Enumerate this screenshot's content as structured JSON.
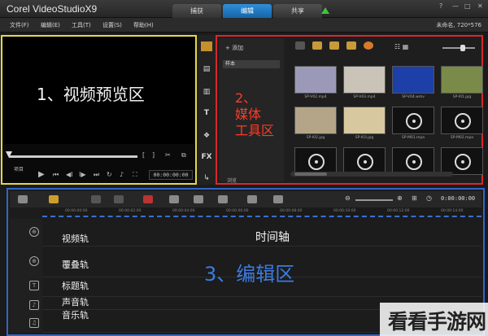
{
  "window": {
    "app_title": "Corel VideoStudioX9",
    "tabs": [
      "捕获",
      "编辑",
      "共享"
    ],
    "active_tab": "编辑",
    "controls": [
      "?",
      "—",
      "□",
      "✕"
    ]
  },
  "menu": {
    "items": [
      "文件(F)",
      "编辑(E)",
      "工具(T)",
      "设置(S)",
      "帮助(H)"
    ],
    "project_info": "未命名, 720*576"
  },
  "preview": {
    "region_label": "1、视频预览区",
    "mode_label": "项目",
    "timecode": "00:00:00:00"
  },
  "library": {
    "region_label": [
      "2、",
      "媒体",
      "工具区"
    ],
    "add_label": "添加",
    "folder_item": "样本",
    "browse_label": "浏览",
    "thumbnails": [
      {
        "caption": "SP-V02.mp4",
        "color": "#9a9ab8"
      },
      {
        "caption": "SP-V03.mp4",
        "color": "#c9c3b8"
      },
      {
        "caption": "SP-V04.wmv",
        "color": "#1d3fa8"
      },
      {
        "caption": "SP-I01.jpg",
        "color": "#7a8a48"
      },
      {
        "caption": "SP-I02.jpg",
        "color": "#b5a588"
      },
      {
        "caption": "SP-I03.jpg",
        "color": "#d8c8a0"
      },
      {
        "caption": "SP-M01.mpa",
        "color": "#111111"
      },
      {
        "caption": "SP-M02.mpa",
        "color": "#111111"
      },
      {
        "caption": "",
        "color": "#111111"
      },
      {
        "caption": "",
        "color": "#111111"
      },
      {
        "caption": "",
        "color": "#111111"
      },
      {
        "caption": "",
        "color": "#111111"
      }
    ]
  },
  "timeline": {
    "timecode": "0:00:00:00",
    "ruler": [
      "00:00:00:00",
      "00:00:02:00",
      "00:00:04:00",
      "00:00:06:00",
      "00:00:08:00",
      "00:00:10:00",
      "00:00:12:00",
      "00:00:14:00"
    ],
    "header_label": "时间轴",
    "region_label": "3、编辑区",
    "tracks": [
      "视频轨",
      "覆叠轨",
      "标题轨",
      "声音轨",
      "音乐轨"
    ]
  },
  "watermark": "看看手游网"
}
